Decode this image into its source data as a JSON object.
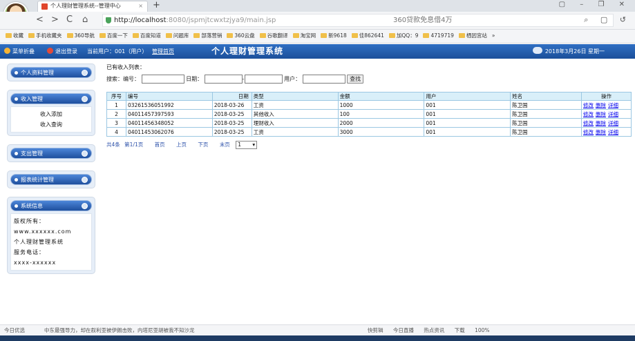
{
  "browser": {
    "tab_title": "个人理财管理系统--管理中心",
    "tab_close": "×",
    "new_tab": "+",
    "window_controls": "▢ – ❐ ✕",
    "url_host": "http://localhost",
    "url_rest": ":8080/jspmjtcwxtzjya9/main.jsp",
    "url_right": "360贷款免息借4万",
    "nav_back": "<",
    "nav_forward": ">",
    "nav_reload": "C",
    "nav_home": "⌂",
    "addr_tools": "⌕ ▢ ↺",
    "bookmarks": [
      "收藏",
      "手机收藏夹",
      "360导航",
      "百度一下",
      "百度知道",
      "问题库",
      "部落营销",
      "360云盘",
      "谷歌翻译",
      "淘宝网",
      "新9618",
      "佳862641",
      "加QQ：9",
      "4719719",
      "栖因宫站"
    ],
    "bookmarks_more": "»",
    "status_left": "今日优选",
    "status_news": "中东最强导力，却在叙利亚被伊朗击败，内塔尼亚胡被我不知沙龙",
    "status_right": [
      "快剪辑",
      "今日直播",
      "热点资讯",
      "下载",
      "100%"
    ]
  },
  "header": {
    "add_fav": "菜单折叠",
    "logout": "退出登录",
    "current_user": "当前用户：001（用户）",
    "admin_link": "管理首页",
    "system_name": "个人理财管理系统",
    "date": "2018年3月26日 星期一"
  },
  "sidebar": {
    "panels": [
      {
        "title": "个人资料管理",
        "items": []
      },
      {
        "title": "收入管理",
        "items": [
          "收入添加",
          "收入查询"
        ]
      },
      {
        "title": "支出管理",
        "items": []
      },
      {
        "title": "报表统计管理",
        "items": []
      }
    ],
    "info": {
      "title": "系统信息",
      "lines": [
        "版权所有：",
        "www.xxxxxx.com",
        "个人理财管理系统",
        "服务电话：",
        "xxxx-xxxxxx"
      ]
    }
  },
  "main": {
    "title": "已有收入列表：",
    "search": {
      "label": "搜索：编号：",
      "date_label": "日期：",
      "date_sep": "-",
      "user_label": "用户：",
      "button": "查找"
    },
    "columns": [
      "序号",
      "编号",
      "日期",
      "类型",
      "金额",
      "用户",
      "姓名",
      "操作"
    ],
    "rows": [
      {
        "no": "1",
        "code": "03261536051992",
        "date": "2018-03-26",
        "type": "工资",
        "amount": "1000",
        "user": "001",
        "name": "陈卫国"
      },
      {
        "no": "2",
        "code": "04011457397593",
        "date": "2018-03-25",
        "type": "其他收入",
        "amount": "100",
        "user": "001",
        "name": "陈卫国"
      },
      {
        "no": "3",
        "code": "04011456348052",
        "date": "2018-03-25",
        "type": "理财收入",
        "amount": "2000",
        "user": "001",
        "name": "陈卫国"
      },
      {
        "no": "4",
        "code": "04011453062076",
        "date": "2018-03-25",
        "type": "工资",
        "amount": "3000",
        "user": "001",
        "name": "陈卫国"
      }
    ],
    "actions": [
      "修改",
      "删除",
      "详细"
    ],
    "pager": {
      "total": "共4条",
      "page": "第1/1页",
      "first": "首页",
      "prev": "上页",
      "next": "下页",
      "last": "末页",
      "select": "1"
    }
  },
  "colors": {
    "header_bg": "#1b4f9a",
    "table_header_bg": "#d9eff9",
    "link": "#0000ee"
  }
}
